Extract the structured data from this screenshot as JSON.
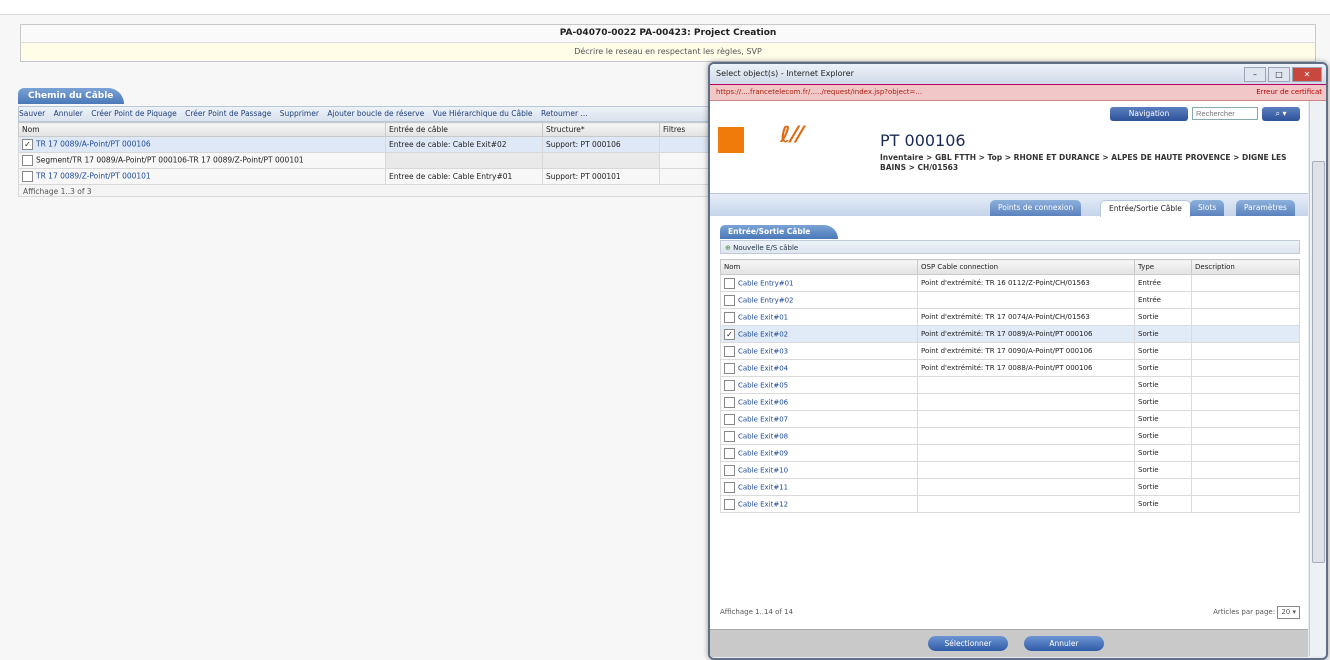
{
  "header": {
    "title": "PA-04070-0022 PA-00423: Project Creation",
    "subtitle": "Décrire le reseau en respectant les règles, SVP"
  },
  "main_panel": {
    "tab": "Chemin du Câble",
    "toolbar": [
      "Sauver",
      "Annuler",
      "Créer Point de Piquage",
      "Créer Point de Passage",
      "Supprimer",
      "Ajouter boucle de réserve",
      "Vue Hiérarchique du Câble",
      "Retourner ..."
    ],
    "columns": [
      "Nom",
      "Entrée de câble",
      "Structure*",
      "Filtres"
    ],
    "rows": [
      {
        "checked": true,
        "name": "TR 17 0089/A-Point/PT 000106",
        "entry": "Entree de cable: Cable Exit#02",
        "structure": "Support: PT 000106"
      },
      {
        "checked": false,
        "name": "Segment/TR 17 0089/A-Point/PT 000106-TR 17 0089/Z-Point/PT 000101",
        "entry": "",
        "structure": ""
      },
      {
        "checked": false,
        "name": "TR 17 0089/Z-Point/PT 000101",
        "entry": "Entree de cable: Cable Entry#01",
        "structure": "Support: PT 000101"
      }
    ],
    "pager": "Affichage 1..3 of 3"
  },
  "popup": {
    "window_title": "Select object(s) - Internet Explorer",
    "address": "https://....francetelecom.fr/...../request/index.jsp?object=...",
    "cert_error": "Erreur de certificat",
    "nav_button": "Navigation",
    "search_placeholder": "Rechercher",
    "pt_title": "PT 000106",
    "breadcrumb": "Inventaire > GBL FTTH > Top > RHONE ET DURANCE > ALPES DE HAUTE PROVENCE > DIGNE LES BAINS > CH/01563",
    "tabs": [
      "Points de connexion",
      "Entrée/Sortie Câble",
      "Slots",
      "Paramètres"
    ],
    "subtab": "Entrée/Sortie Câble",
    "new_label": "Nouvelle E/S câble",
    "columns": [
      "Nom",
      "OSP Cable connection",
      "Type",
      "Description"
    ],
    "rows": [
      {
        "checked": false,
        "name": "Cable Entry#01",
        "conn": "Point d'extrémité: TR 16 0112/Z-Point/CH/01563",
        "type": "Entrée"
      },
      {
        "checked": false,
        "name": "Cable Entry#02",
        "conn": "",
        "type": "Entrée"
      },
      {
        "checked": false,
        "name": "Cable Exit#01",
        "conn": "Point d'extrémité: TR 17 0074/A-Point/CH/01563",
        "type": "Sortie"
      },
      {
        "checked": true,
        "name": "Cable Exit#02",
        "conn": "Point d'extrémité: TR 17 0089/A-Point/PT 000106",
        "type": "Sortie"
      },
      {
        "checked": false,
        "name": "Cable Exit#03",
        "conn": "Point d'extrémité: TR 17 0090/A-Point/PT 000106",
        "type": "Sortie"
      },
      {
        "checked": false,
        "name": "Cable Exit#04",
        "conn": "Point d'extrémité: TR 17 0088/A-Point/PT 000106",
        "type": "Sortie"
      },
      {
        "checked": false,
        "name": "Cable Exit#05",
        "conn": "",
        "type": "Sortie"
      },
      {
        "checked": false,
        "name": "Cable Exit#06",
        "conn": "",
        "type": "Sortie"
      },
      {
        "checked": false,
        "name": "Cable Exit#07",
        "conn": "",
        "type": "Sortie"
      },
      {
        "checked": false,
        "name": "Cable Exit#08",
        "conn": "",
        "type": "Sortie"
      },
      {
        "checked": false,
        "name": "Cable Exit#09",
        "conn": "",
        "type": "Sortie"
      },
      {
        "checked": false,
        "name": "Cable Exit#10",
        "conn": "",
        "type": "Sortie"
      },
      {
        "checked": false,
        "name": "Cable Exit#11",
        "conn": "",
        "type": "Sortie"
      },
      {
        "checked": false,
        "name": "Cable Exit#12",
        "conn": "",
        "type": "Sortie"
      }
    ],
    "pager": "Affichage 1..14 of 14",
    "per_page_label": "Articles par page:",
    "per_page_value": "20",
    "select_button": "Sélectionner",
    "cancel_button": "Annuler"
  }
}
